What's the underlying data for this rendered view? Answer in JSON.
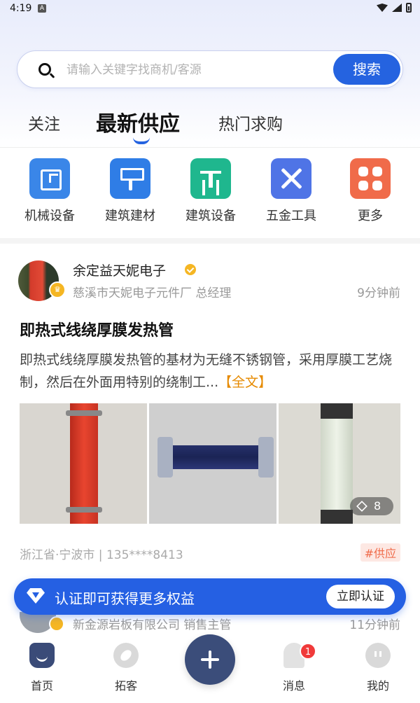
{
  "status_bar": {
    "time": "4:19",
    "notification_badge": "A"
  },
  "search": {
    "placeholder": "请输入关键字找商机/客源",
    "button_label": "搜索"
  },
  "tabs": [
    {
      "label": "关注",
      "active": false
    },
    {
      "label": "最新供应",
      "active": true
    },
    {
      "label": "热门求购",
      "active": false
    }
  ],
  "categories": [
    {
      "label": "机械设备",
      "icon": "machine-icon",
      "color": "#3a86e8"
    },
    {
      "label": "建筑建材",
      "icon": "paint-roller-icon",
      "color": "#2f7de6"
    },
    {
      "label": "建筑设备",
      "icon": "construction-icon",
      "color": "#1fb78e"
    },
    {
      "label": "五金工具",
      "icon": "tools-icon",
      "color": "#4f74e6"
    },
    {
      "label": "更多",
      "icon": "grid-icon",
      "color": "#f06b4a"
    }
  ],
  "post": {
    "author": "余定益天妮电子",
    "verified": true,
    "company": "慈溪市天妮电子元件厂 总经理",
    "time": "9分钟前",
    "title": "即热式线绕厚膜发热管",
    "description": "即热式线绕厚膜发热管的基材为无缝不锈钢管，采用厚膜工艺烧制，然后在外面用特别的绕制工...",
    "read_more": "【全文】",
    "image_count": "8",
    "location": "浙江省·宁波市 | 135****8413",
    "tag": "#供应"
  },
  "next_post": {
    "company": "新金源岩板有限公司 销售主管",
    "time": "11分钟前"
  },
  "cert_banner": {
    "text": "认证即可获得更多权益",
    "button": "立即认证"
  },
  "bottom_nav": [
    {
      "label": "首页",
      "icon": "home-icon",
      "active": true
    },
    {
      "label": "拓客",
      "icon": "compass-icon",
      "active": false
    },
    {
      "label": "",
      "icon": "plus-icon",
      "active": false
    },
    {
      "label": "消息",
      "icon": "bell-icon",
      "active": false,
      "badge": "1"
    },
    {
      "label": "我的",
      "icon": "profile-icon",
      "active": false
    }
  ],
  "colors": {
    "accent": "#2563e0",
    "orange": "#e68a00",
    "tag": "#f06b4a",
    "nav_dark": "#3b4d7a"
  }
}
